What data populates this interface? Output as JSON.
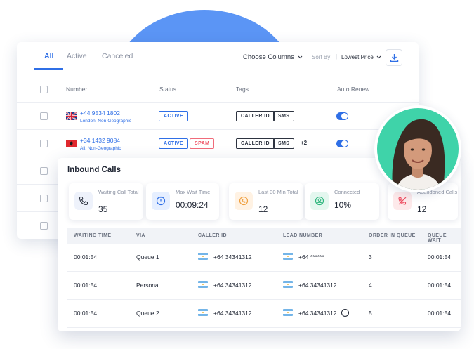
{
  "tabs": [
    {
      "label": "All",
      "active": true
    },
    {
      "label": "Active",
      "active": false
    },
    {
      "label": "Canceled",
      "active": false
    }
  ],
  "toolbar": {
    "choose_columns": "Choose Columns",
    "sort_by_label": "Sort By",
    "sort_by_value": "Lowest Price"
  },
  "numbers_table": {
    "headers": [
      "Number",
      "Status",
      "Tags",
      "Auto Renew"
    ],
    "rows": [
      {
        "number": "+44 9534 1802",
        "location": "London, Non-Geographic",
        "flag": "uk-flag-icon",
        "status": [
          "ACTIVE"
        ],
        "tags": [
          "CALLER ID",
          "SMS"
        ],
        "extra_tags": "",
        "auto_renew": true
      },
      {
        "number": "+34 1432 9084",
        "location": "All, Non-Geographic",
        "flag": "albania-flag-icon",
        "status": [
          "ACTIVE",
          "SPAM"
        ],
        "tags": [
          "CALLER ID",
          "SMS"
        ],
        "extra_tags": "+2",
        "auto_renew": true
      }
    ]
  },
  "inbound": {
    "title": "Inbound Calls",
    "stats": [
      {
        "label": "Waiting Call Total",
        "value": "35",
        "icon": "phone-icon",
        "color": "#eef2fb"
      },
      {
        "label": "Max Wait Time",
        "value": "00:09:24",
        "icon": "timer-icon",
        "color": "#e6efff"
      },
      {
        "label": "Last 30 Min Total",
        "value": "12",
        "icon": "phone-ring-icon",
        "color": "#fff2e3"
      },
      {
        "label": "Connected",
        "value": "10%",
        "icon": "user-circle-icon",
        "color": "#e4f7ef"
      },
      {
        "label": "Abandoned Calls",
        "value": "12",
        "icon": "phone-off-icon",
        "color": "#fde9ea"
      }
    ],
    "headers": [
      "WAITING TIME",
      "VIA",
      "CALLER ID",
      "LEAD NUMBER",
      "ORDER IN QUEUE",
      "QUEUE WAIT"
    ],
    "rows": [
      {
        "waiting_time": "00:01:54",
        "via": "Queue 1",
        "caller_id": "+64 34341312",
        "lead_number": "+64 ******",
        "order": "3",
        "queue_wait": "00:01:54",
        "info": false
      },
      {
        "waiting_time": "00:01:54",
        "via": "Personal",
        "caller_id": "+64 34341312",
        "lead_number": "+64 34341312",
        "order": "4",
        "queue_wait": "00:01:54",
        "info": false
      },
      {
        "waiting_time": "00:01:54",
        "via": "Queue 2",
        "caller_id": "+64 34341312",
        "lead_number": "+64 34341312",
        "order": "5",
        "queue_wait": "00:01:54",
        "info": true
      }
    ]
  },
  "colors": {
    "accent": "#2f6fe6",
    "spam": "#ee4e61",
    "avatar_bg": "#3fd3a9",
    "blob": "#5b95f5"
  }
}
